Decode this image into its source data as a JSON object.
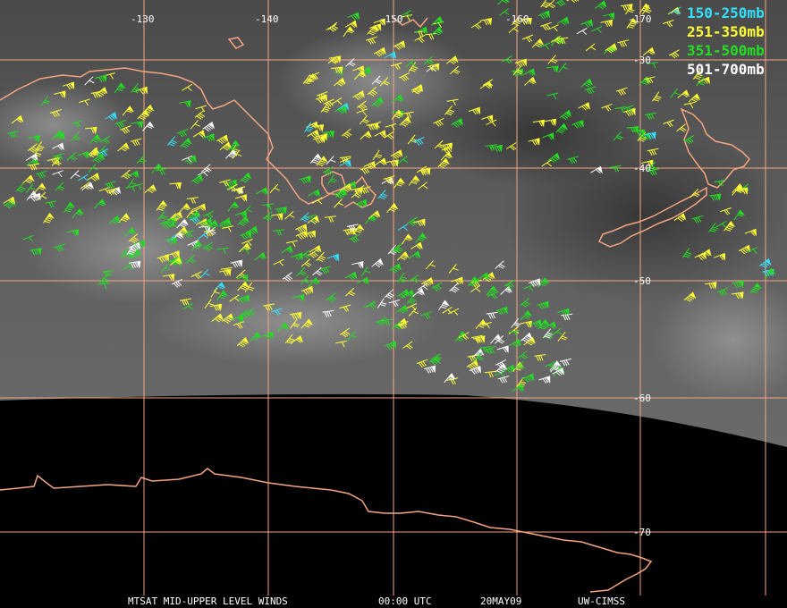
{
  "legend": [
    {
      "label": "150-250mb",
      "color": "#33e0ff"
    },
    {
      "label": "251-350mb",
      "color": "#ffff33"
    },
    {
      "label": "351-500mb",
      "color": "#22dd22"
    },
    {
      "label": "501-700mb",
      "color": "#ffffff"
    }
  ],
  "longitude_labels": [
    "-130",
    "-140",
    "-150",
    "-160",
    "-170"
  ],
  "latitude_labels": [
    "-30",
    "-40",
    "-50",
    "-60",
    "-70"
  ],
  "footer": {
    "product": "MTSAT MID-UPPER LEVEL WINDS",
    "time": "00:00 UTC",
    "date": "20MAY09",
    "credit": "UW-CIMSS"
  },
  "colors": {
    "grid": "#f4a582",
    "coast": "#f4a582",
    "background": "#000000"
  }
}
